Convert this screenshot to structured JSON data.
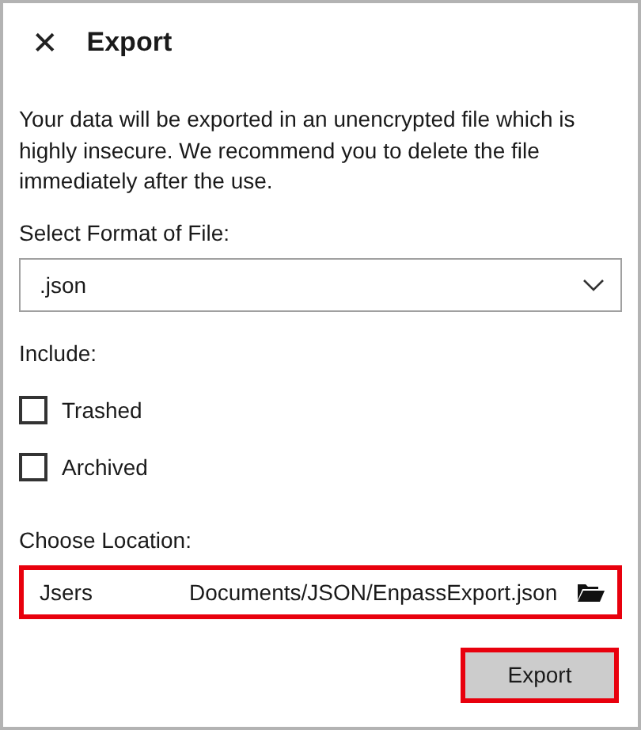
{
  "window": {
    "close": "✕",
    "title": "Export"
  },
  "message": "Your data will be exported in an unencrypted file which is highly insecure. We recommend you to delete the file immediately after the use.",
  "format": {
    "label": "Select Format of File:",
    "value": ".json"
  },
  "include": {
    "label": "Include:",
    "options": [
      {
        "label": "Trashed",
        "checked": false
      },
      {
        "label": "Archived",
        "checked": false
      }
    ]
  },
  "location": {
    "label": "Choose Location:",
    "value_parts": [
      "Jsers",
      "Documents/JSON/EnpassExport.json"
    ],
    "highlighted": true
  },
  "export_button": {
    "label": "Export",
    "highlighted": true
  }
}
